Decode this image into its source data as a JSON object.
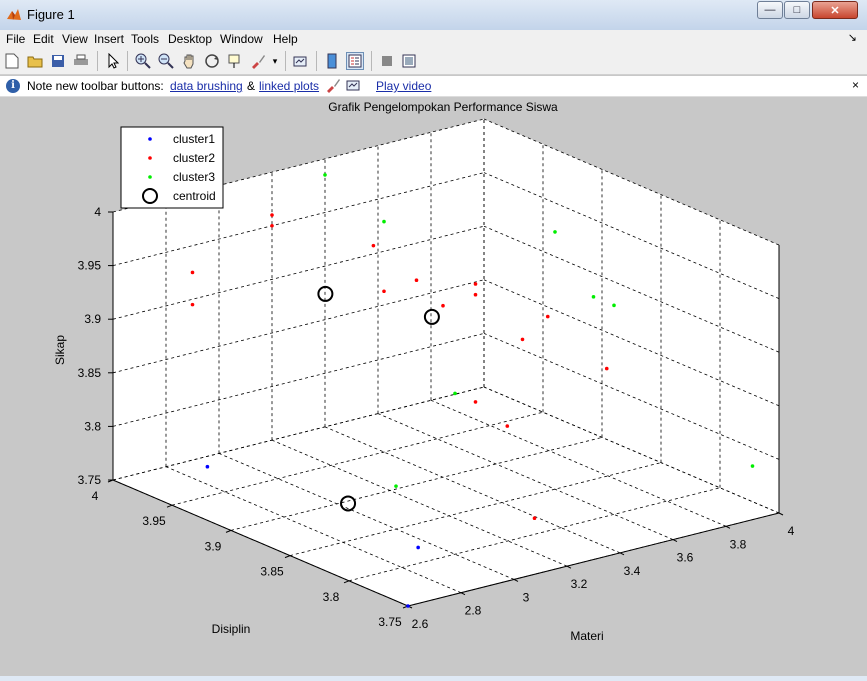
{
  "window": {
    "title": "Figure 1",
    "min_glyph": "—",
    "max_glyph": "□",
    "close_glyph": "✕"
  },
  "menu": {
    "items": [
      "File",
      "Edit",
      "View",
      "Insert",
      "Tools",
      "Desktop",
      "Window",
      "Help"
    ],
    "arrow": "↘"
  },
  "infobar": {
    "prefix": "Note new toolbar buttons:",
    "link1": "data brushing",
    "amp": "&",
    "link2": "linked plots",
    "link3": "Play video",
    "close_glyph": "×"
  },
  "colors": {
    "cluster1": "#0000ff",
    "cluster2": "#ff0000",
    "cluster3": "#00ee00",
    "axes_bg": "#ffffff",
    "figure_bg": "#c8c8c8"
  },
  "chart_data": {
    "type": "scatter",
    "title": "Grafik Pengelompokan Performance Siswa",
    "xlabel": "Materi",
    "ylabel": "Disiplin",
    "zlabel": "Sikap",
    "xlim": [
      2.6,
      4
    ],
    "ylim": [
      3.75,
      4
    ],
    "zlim": [
      3.75,
      4
    ],
    "xticks": [
      "2.6",
      "2.8",
      "3",
      "3.2",
      "3.4",
      "3.6",
      "3.8",
      "4"
    ],
    "yticks": [
      "3.75",
      "3.8",
      "3.85",
      "3.9",
      "3.95",
      "4"
    ],
    "zticks": [
      "3.75",
      "3.8",
      "3.85",
      "3.9",
      "3.95",
      "4"
    ],
    "grid": true,
    "legend_position": "top-left",
    "legend": [
      "cluster1",
      "cluster2",
      "cluster3",
      "centroid"
    ],
    "series": [
      {
        "name": "cluster1",
        "marker": "dot",
        "points": [
          [
            2.6,
            3.75,
            3.75
          ],
          [
            2.95,
            3.82,
            3.75
          ],
          [
            2.6,
            3.92,
            3.8
          ]
        ]
      },
      {
        "name": "cluster2",
        "marker": "dot",
        "points": [
          [
            3.35,
            3.75,
            3.925
          ],
          [
            3.35,
            3.8,
            3.95
          ],
          [
            3.3,
            3.85,
            3.96
          ],
          [
            3.3,
            3.85,
            3.95
          ],
          [
            3.3,
            3.9,
            3.94
          ],
          [
            3.4,
            3.9,
            3.91
          ],
          [
            3.36,
            3.95,
            3.945
          ],
          [
            3.4,
            3.95,
            3.9
          ],
          [
            3.2,
            4.0,
            3.96
          ],
          [
            3.2,
            4.0,
            3.95
          ],
          [
            2.9,
            4.0,
            3.925
          ],
          [
            2.9,
            4.0,
            3.895
          ],
          [
            3.3,
            3.85,
            3.85
          ],
          [
            3.42,
            3.85,
            3.82
          ],
          [
            3.7,
            3.9,
            3.86
          ],
          [
            3.3,
            3.8,
            3.765
          ]
        ]
      },
      {
        "name": "cluster3",
        "marker": "dot",
        "points": [
          [
            3.4,
            4.0,
            3.985
          ],
          [
            3.4,
            3.95,
            3.965
          ],
          [
            3.3,
            3.75,
            3.995
          ],
          [
            3.6,
            3.85,
            3.99
          ],
          [
            3.6,
            3.8,
            3.945
          ],
          [
            3.0,
            3.8,
            3.9
          ],
          [
            3.0,
            3.85,
            3.79
          ],
          [
            3.9,
            3.75,
            3.8
          ]
        ]
      },
      {
        "name": "centroid",
        "marker": "circle",
        "points": [
          [
            3.21,
            3.957,
            3.906
          ],
          [
            3.18,
            3.86,
            3.932
          ],
          [
            2.73,
            3.83,
            3.8
          ]
        ]
      }
    ]
  }
}
